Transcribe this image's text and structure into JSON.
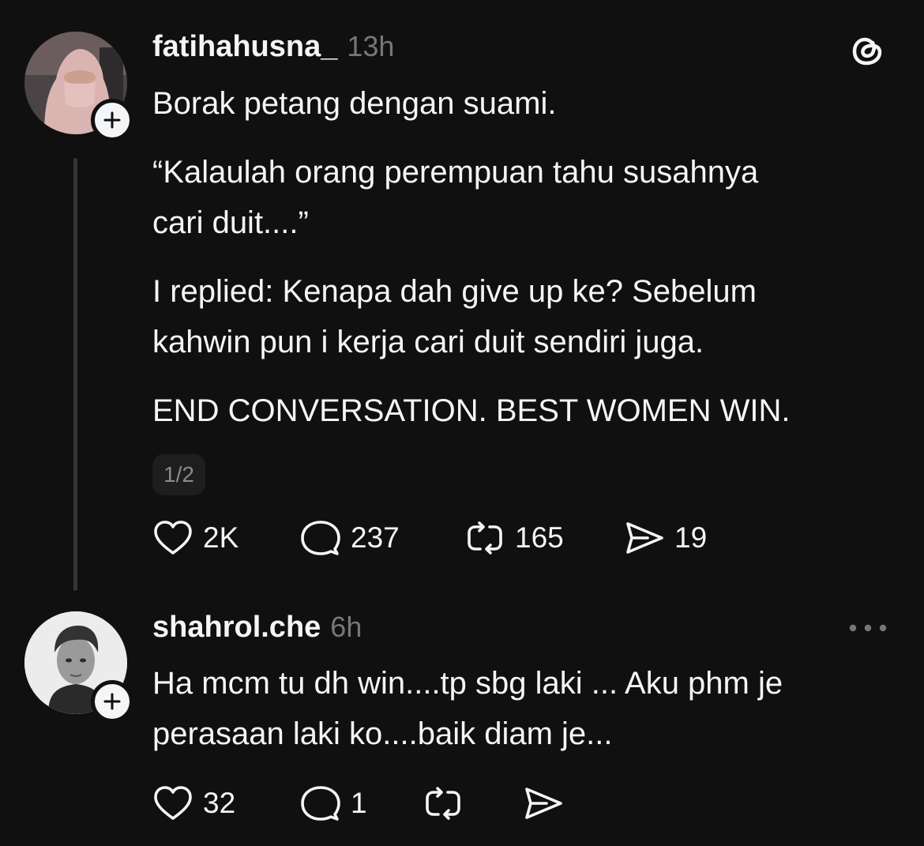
{
  "post": {
    "username": "fatihahusna_",
    "time": "13h",
    "paragraphs": [
      [
        "Borak petang dengan suami."
      ],
      [
        "“Kalaulah orang perempuan tahu susahnya",
        "cari duit....”"
      ],
      [
        "I replied: Kenapa dah give up ke? Sebelum",
        "kahwin pun i kerja cari duit sendiri juga."
      ],
      [
        "END CONVERSATION. BEST WOMEN WIN."
      ]
    ],
    "page_indicator": "1/2",
    "actions": {
      "likes": "2K",
      "replies": "237",
      "reposts": "165",
      "shares": "19"
    }
  },
  "reply": {
    "username": "shahrol.che",
    "time": "6h",
    "lines": [
      "Ha mcm tu dh win....tp sbg laki ... Aku phm je",
      "perasaan laki ko....baik diam je..."
    ],
    "actions": {
      "likes": "32",
      "replies": "1"
    }
  },
  "icons": [
    "threads-logo-icon",
    "plus-icon",
    "heart-icon",
    "comment-icon",
    "repost-icon",
    "share-icon",
    "more-icon"
  ]
}
